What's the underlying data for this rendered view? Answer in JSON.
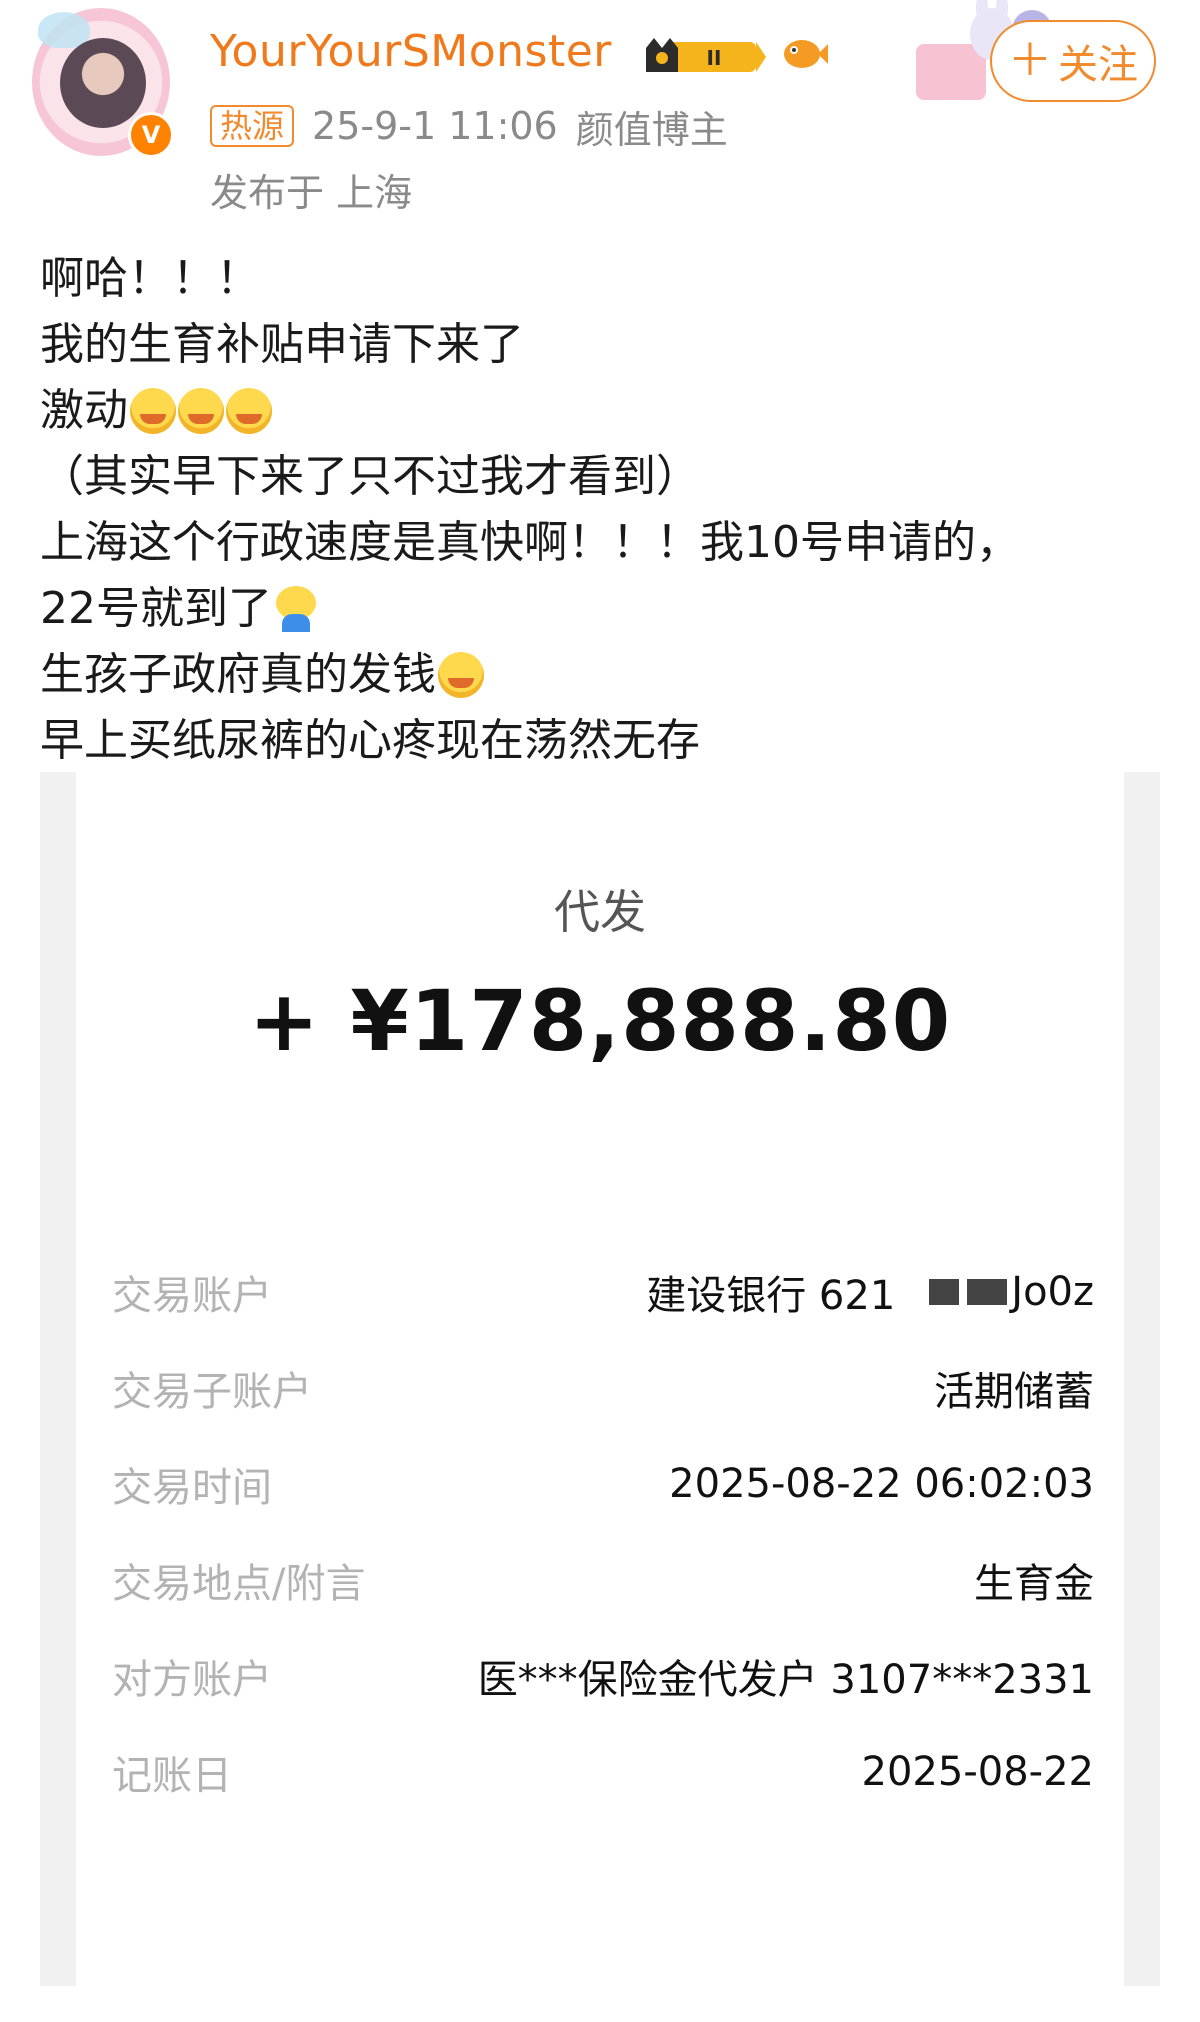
{
  "post": {
    "username": "YourYourSMonster",
    "level_badge_text": "II",
    "hot_tag": "热源",
    "timestamp": "25-9-1 11:06",
    "user_title": "颜值博主",
    "location": "发布于 上海",
    "follow_label": "关注",
    "text_lines": [
      "啊哈！！！",
      "我的生育补贴申请下来了",
      "激动",
      "（其实早下来了只不过我才看到）",
      "上海这个行政速度是真快啊！！！我10号申请的，",
      "22号就到了",
      "生孩子政府真的发钱",
      "早上买纸尿裤的心疼现在荡然无存"
    ]
  },
  "receipt": {
    "title": "代发",
    "amount": "+ ¥178,888.80",
    "rows": [
      {
        "label": "交易账户",
        "value": "建设银行 621",
        "masked_suffix": "Jo0z"
      },
      {
        "label": "交易子账户",
        "value": "活期储蓄"
      },
      {
        "label": "交易时间",
        "value": "2025-08-22 06:02:03"
      },
      {
        "label": "交易地点/附言",
        "value": "生育金"
      },
      {
        "label": "对方账户",
        "value": "医***保险金代发户 3107***2331"
      },
      {
        "label": "记账日",
        "value": "2025-08-22"
      }
    ]
  },
  "colors": {
    "accent_orange": "#f07a1b",
    "meta_gray": "#8a8a8a",
    "label_gray": "#b3b3b3"
  },
  "icons": [
    "verified-icon",
    "level-crown-icon",
    "fish-icon",
    "plus-icon",
    "crying-emoji",
    "facepalm-emoji"
  ]
}
